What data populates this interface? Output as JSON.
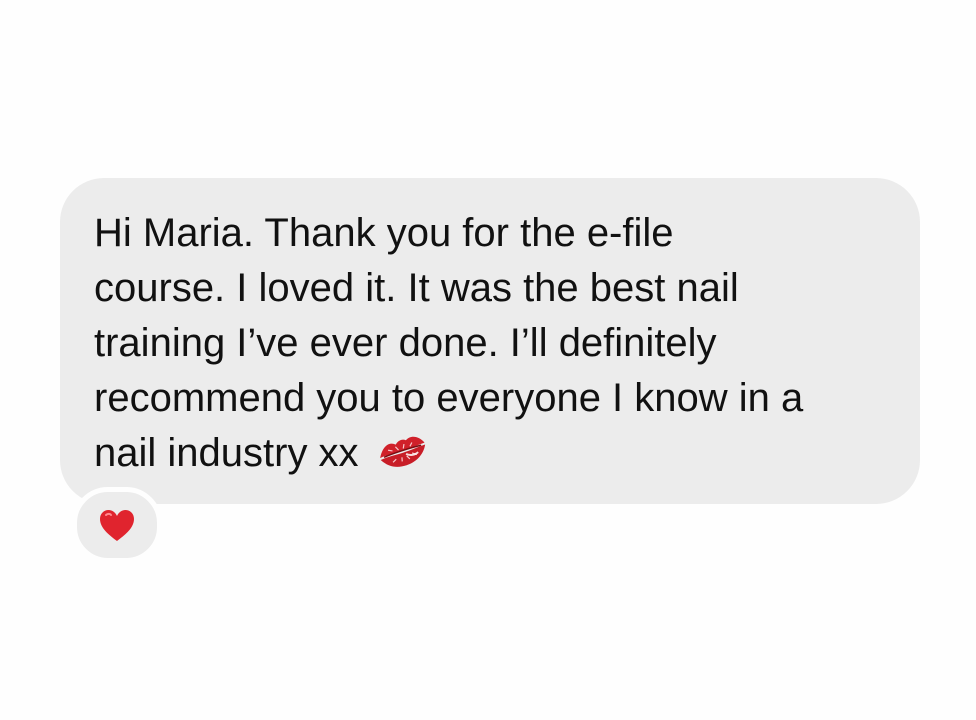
{
  "message": {
    "lines": [
      "Hi Maria. Thank you for the e-file",
      "course. I loved it. It was the best nail",
      "training I’ve ever done. I’ll definitely",
      "recommend you to everyone I know in a",
      "nail industry xx"
    ],
    "trailing_emoji": "kiss-mark-icon"
  },
  "reaction": {
    "emoji": "red-heart-icon"
  },
  "colors": {
    "page_background": "#fefefe",
    "bubble_background": "#ececec",
    "text": "#111111",
    "heart": "#e0242e",
    "kiss": "#d0202a"
  }
}
